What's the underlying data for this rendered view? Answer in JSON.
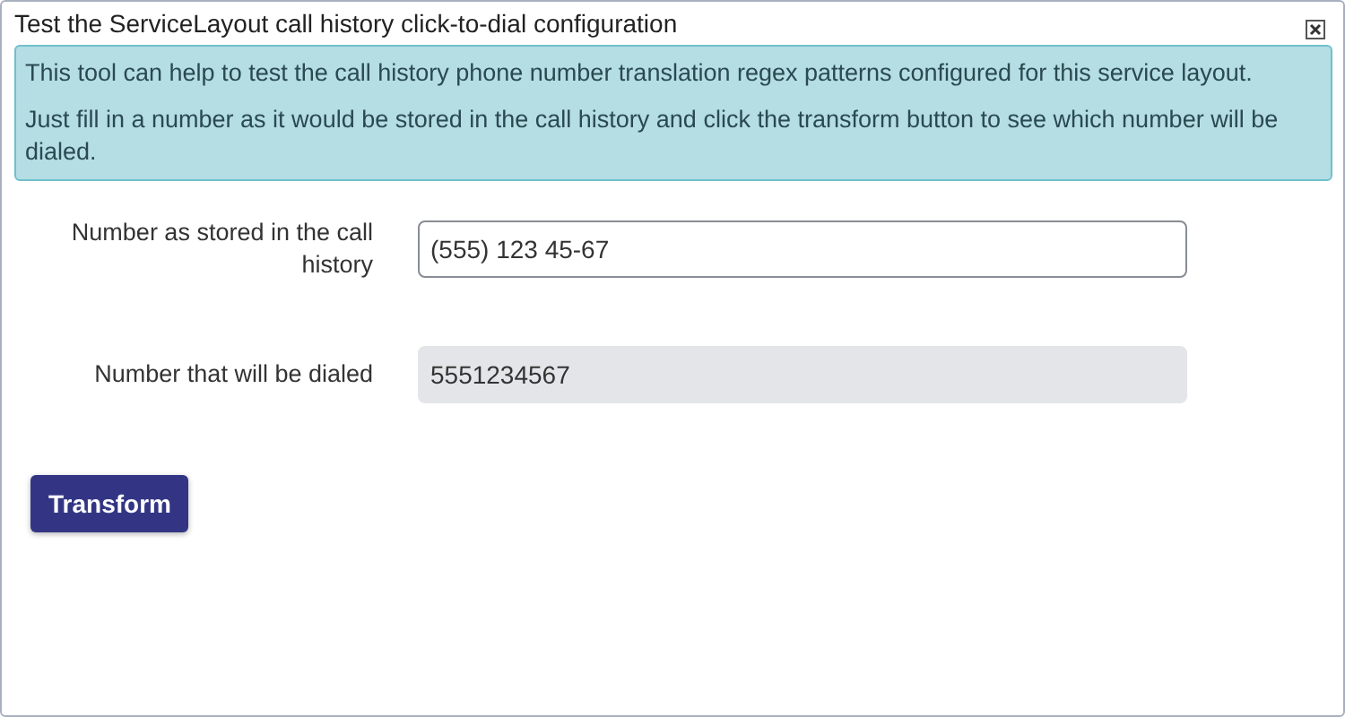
{
  "dialog": {
    "title": "Test the ServiceLayout call history click-to-dial configuration"
  },
  "info": [
    "This tool can help to test the call history phone number translation regex patterns configured for this service layout.",
    "Just fill in a number as it would be stored in the call history and click the transform button to see which number will be dialed."
  ],
  "fields": [
    {
      "label": "Number as stored in the call history",
      "value": "(555) 123 45-67",
      "kind": "editable"
    },
    {
      "label": "Number that will be dialed",
      "value": "5551234567",
      "kind": "readonly"
    }
  ],
  "buttons": [
    "Transform"
  ]
}
